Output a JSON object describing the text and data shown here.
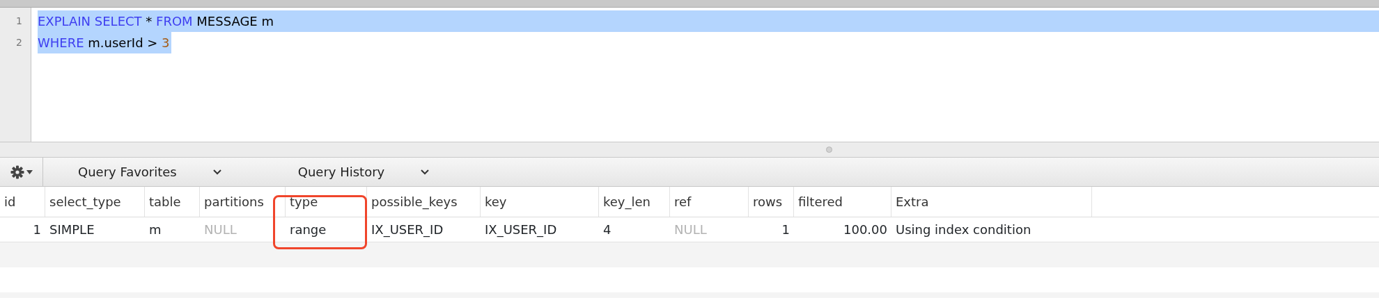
{
  "editor": {
    "lines": [
      {
        "number": "1",
        "selected": true,
        "tokens": [
          {
            "text": "EXPLAIN SELECT",
            "kind": "keyword"
          },
          {
            "text": " * ",
            "kind": "plain"
          },
          {
            "text": "FROM",
            "kind": "keyword"
          },
          {
            "text": " MESSAGE m",
            "kind": "plain"
          }
        ]
      },
      {
        "number": "2",
        "selected": true,
        "tokens": [
          {
            "text": "WHERE",
            "kind": "keyword"
          },
          {
            "text": " m.userId > ",
            "kind": "plain"
          },
          {
            "text": "3",
            "kind": "number"
          }
        ]
      }
    ]
  },
  "toolbar": {
    "menus": [
      {
        "label": "Query Favorites"
      },
      {
        "label": "Query History"
      }
    ]
  },
  "results": {
    "columns": [
      {
        "label": "id",
        "numeric": true,
        "highlighted": false
      },
      {
        "label": "select_type",
        "numeric": false,
        "highlighted": false
      },
      {
        "label": "table",
        "numeric": false,
        "highlighted": false
      },
      {
        "label": "partitions",
        "numeric": false,
        "highlighted": false
      },
      {
        "label": "type",
        "numeric": false,
        "highlighted": true
      },
      {
        "label": "possible_keys",
        "numeric": false,
        "highlighted": false
      },
      {
        "label": "key",
        "numeric": false,
        "highlighted": false
      },
      {
        "label": "key_len",
        "numeric": false,
        "highlighted": false
      },
      {
        "label": "ref",
        "numeric": false,
        "highlighted": false
      },
      {
        "label": "rows",
        "numeric": true,
        "highlighted": false
      },
      {
        "label": "filtered",
        "numeric": true,
        "highlighted": false
      },
      {
        "label": "Extra",
        "numeric": false,
        "highlighted": false
      }
    ],
    "rows": [
      {
        "cells": [
          {
            "text": "1",
            "is_null": false
          },
          {
            "text": "SIMPLE",
            "is_null": false
          },
          {
            "text": "m",
            "is_null": false
          },
          {
            "text": "NULL",
            "is_null": true
          },
          {
            "text": "range",
            "is_null": false
          },
          {
            "text": "IX_USER_ID",
            "is_null": false
          },
          {
            "text": "IX_USER_ID",
            "is_null": false
          },
          {
            "text": "4",
            "is_null": false
          },
          {
            "text": "NULL",
            "is_null": true
          },
          {
            "text": "1",
            "is_null": false
          },
          {
            "text": "100.00",
            "is_null": false
          },
          {
            "text": "Using index condition",
            "is_null": false
          }
        ]
      }
    ]
  }
}
